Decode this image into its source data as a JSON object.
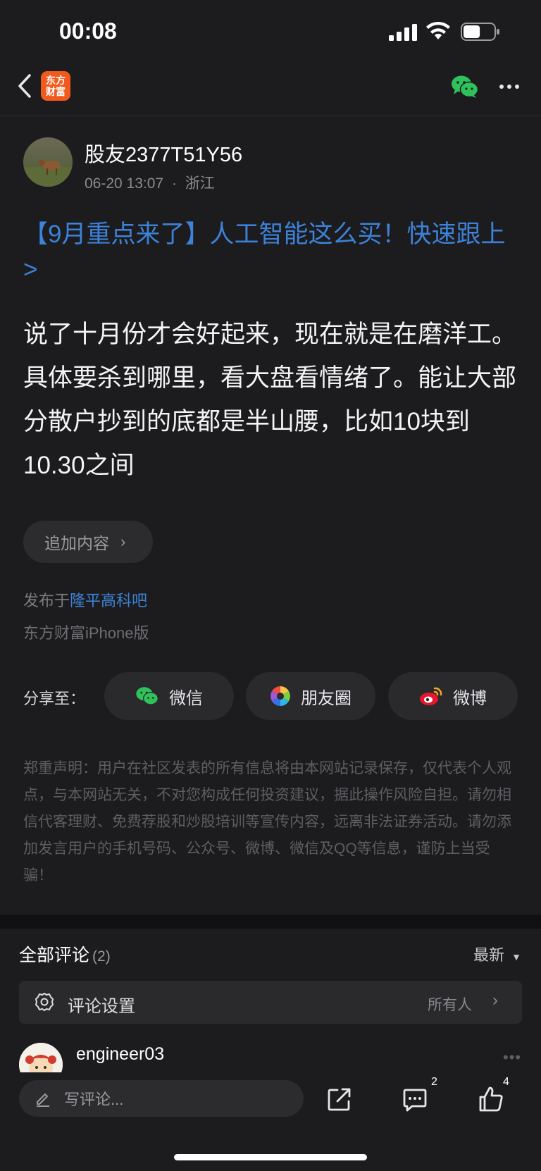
{
  "status_bar": {
    "time": "00:08",
    "battery_level": 0.55
  },
  "nav": {
    "logo_text_line1": "东方",
    "logo_text_line2": "财富",
    "logo_color": "#f25a1d"
  },
  "post": {
    "author": "股友2377T51Y56",
    "date": "06-20 13:07",
    "separator": "·",
    "location": "浙江",
    "promo_link": "【9月重点来了】人工智能这么买！快速跟上>",
    "body": "说了十月份才会好起来，现在就是在磨洋工。具体要杀到哪里，看大盘看情绪了。能让大部分散户抄到的底都是半山腰，比如10块到10.30之间",
    "add_content_label": "追加内容",
    "published_prefix": "发布于",
    "published_forum": "隆平高科吧",
    "client": "东方财富iPhone版"
  },
  "share": {
    "label": "分享至：",
    "buttons": [
      {
        "label": "微信",
        "icon": "wechat-icon"
      },
      {
        "label": "朋友圈",
        "icon": "moments-icon"
      },
      {
        "label": "微博",
        "icon": "weibo-icon"
      }
    ]
  },
  "disclaimer": "郑重声明：用户在社区发表的所有信息将由本网站记录保存，仅代表个人观点，与本网站无关，不对您构成任何投资建议，据此操作风险自担。请勿相信代客理财、免费荐股和炒股培训等宣传内容，远离非法证券活动。请勿添加发言用户的手机号码、公众号、微博、微信及QQ等信息，谨防上当受骗！",
  "comments": {
    "title": "全部评论",
    "count": "(2)",
    "sort_label": "最新",
    "settings_label": "评论设置",
    "settings_value": "所有人",
    "first_commenter": "engineer03"
  },
  "bottom_bar": {
    "write_placeholder": "写评论...",
    "comment_count": "2",
    "like_count": "4"
  },
  "colors": {
    "accent_blue": "#3d82d8",
    "wechat_green": "#2fc25b",
    "background": "#1c1c1e"
  }
}
